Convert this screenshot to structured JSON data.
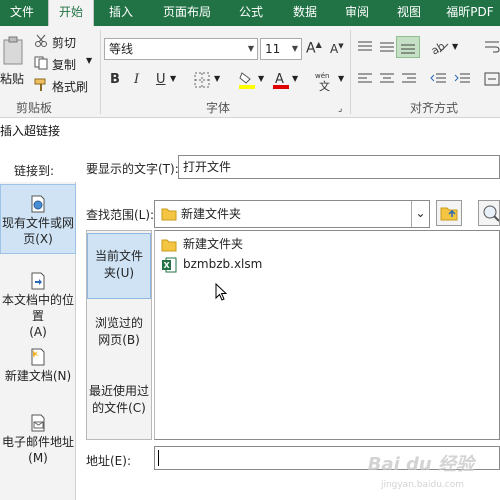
{
  "ribbon": {
    "tabs": [
      "文件",
      "开始",
      "插入",
      "页面布局",
      "公式",
      "数据",
      "审阅",
      "视图",
      "福昕PDF"
    ],
    "active_tab": "开始",
    "clipboard": {
      "paste_label": "粘贴",
      "cut_label": "剪切",
      "copy_label": "复制",
      "format_painter_label": "格式刷",
      "group_label": "剪贴板"
    },
    "font": {
      "font_name": "等线",
      "font_size": "11",
      "bold": "B",
      "italic": "I",
      "underline": "U",
      "group_label": "字体"
    },
    "alignment": {
      "group_label": "对齐方式"
    },
    "accent_color": "#217346"
  },
  "dialog": {
    "title": "插入超链接",
    "link_to_label": "链接到:",
    "link_types": [
      {
        "label": "现有文件或网页(X)",
        "line1": "现有文件或网",
        "line2": "页(X)",
        "icon": "globe-file-icon"
      },
      {
        "label": "本文档中的位置(A)",
        "line1": "本文档中的位置",
        "line2": "(A)",
        "icon": "document-place-icon"
      },
      {
        "label": "新建文档(N)",
        "line1": "新建文档(N)",
        "line2": "",
        "icon": "new-document-icon"
      },
      {
        "label": "电子邮件地址(M)",
        "line1": "电子邮件地址",
        "line2": "(M)",
        "icon": "email-icon"
      }
    ],
    "display_text_label": "要显示的文字(T):",
    "display_text_value": "打开文件",
    "look_in_label": "查找范围(L):",
    "look_in_value": "新建文件夹",
    "places": [
      {
        "line1": "当前文件",
        "line2": "夹(U)"
      },
      {
        "line1": "浏览过的",
        "line2": "网页(B)"
      },
      {
        "line1": "最近使用过",
        "line2": "的文件(C)"
      }
    ],
    "files": [
      {
        "name": "新建文件夹",
        "icon": "folder-icon"
      },
      {
        "name": "bzmbzb.xlsm",
        "icon": "excel-file-icon"
      }
    ],
    "address_label": "地址(E):",
    "address_value": ""
  },
  "watermark": {
    "brand": "Bai du 经验",
    "url": "jingyan.baidu.com"
  }
}
